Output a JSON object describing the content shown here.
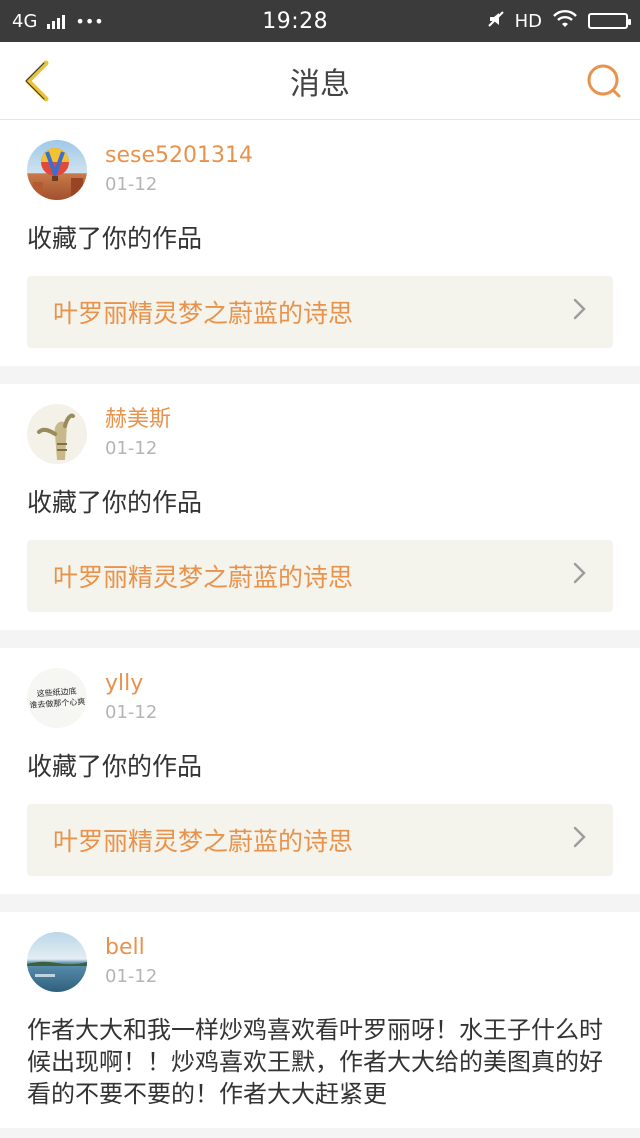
{
  "statusbar": {
    "network": "4G",
    "dots": "•••",
    "time": "19:28",
    "hd": "HD"
  },
  "nav": {
    "title": "消息"
  },
  "items": [
    {
      "username": "sese5201314",
      "date": "01-12",
      "action": "收藏了你的作品",
      "work_title": "叶罗丽精灵梦之蔚蓝的诗思"
    },
    {
      "username": "赫美斯",
      "date": "01-12",
      "action": "收藏了你的作品",
      "work_title": "叶罗丽精灵梦之蔚蓝的诗思"
    },
    {
      "username": "ylly",
      "date": "01-12",
      "action": "收藏了你的作品",
      "work_title": "叶罗丽精灵梦之蔚蓝的诗思"
    },
    {
      "username": "bell",
      "date": "01-12",
      "comment": "作者大大和我一样炒鸡喜欢看叶罗丽呀！水王子什么时候出现啊！！炒鸡喜欢王默，作者大大给的美图真的好看的不要不要的！作者大大赶紧更"
    }
  ],
  "avatar3_text": "这些纸边底\n谁去做那个心爽",
  "colors": {
    "accent": "#e8924c",
    "back_icon": "#e8c23a",
    "link_bg": "#f4f4ec"
  }
}
